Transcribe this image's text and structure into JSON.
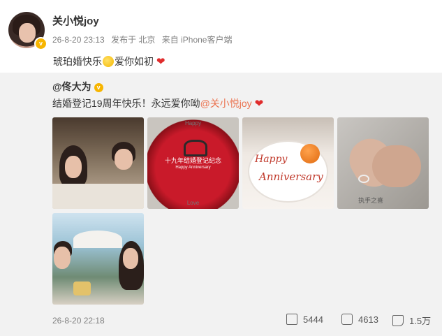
{
  "post": {
    "username": "关小悦joy",
    "timestamp": "26-8-20 23:13",
    "location": "发布于 北京",
    "source": "来自 iPhone客户端",
    "text_before": "琥珀婚快乐",
    "text_after": "爱你如初",
    "heart": "❤"
  },
  "repost": {
    "author": "@佟大为",
    "text": "结婚登记19周年快乐！永远爱你呦",
    "mention": "@关小悦joy",
    "heart": "❤",
    "image2_text_top": "Happy",
    "image2_text_mid": "十九年结婚登记纪念",
    "image2_text_bottom": "Happy Anniversary",
    "image2_text_love": "Love",
    "image3_text_happy": "Happy",
    "image3_text_anniv": "Anniversary",
    "image4_text": "执手之喜",
    "date": "26-8-20 22:18",
    "reposts": "5444",
    "comments": "4613",
    "likes": "1.5万"
  },
  "colors": {
    "mention": "#eb7350",
    "heart": "#e02c2c",
    "badge": "#f7b500",
    "repost_bg": "#f2f2f2"
  },
  "icons": [
    "verified-badge-icon",
    "smile-emoji-icon",
    "repost-icon",
    "comment-icon",
    "like-icon"
  ]
}
